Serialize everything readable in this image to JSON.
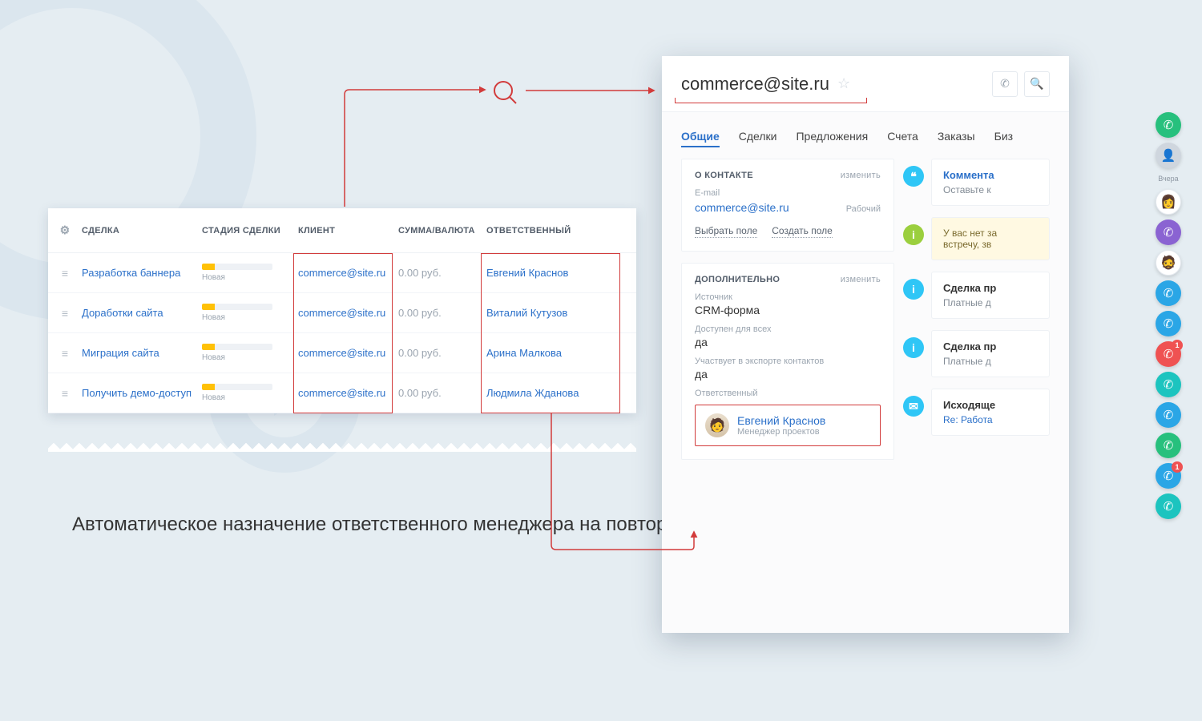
{
  "caption": "Автоматическое назначение ответственного менеджера на повторные обращения клиентов",
  "deals": {
    "headers": {
      "deal": "СДЕЛКА",
      "stage": "СТАДИЯ СДЕЛКИ",
      "client": "КЛИЕНТ",
      "amount": "СУММА/ВАЛЮТА",
      "resp": "ОТВЕТСТВЕННЫЙ"
    },
    "stage_label": "Новая",
    "rows": [
      {
        "name": "Разработка баннера",
        "client": "commerce@site.ru",
        "amount": "0.00 руб.",
        "resp": "Евгений Краснов"
      },
      {
        "name": "Доработки сайта",
        "client": "commerce@site.ru",
        "amount": "0.00 руб.",
        "resp": "Виталий Кутузов"
      },
      {
        "name": "Миграция сайта",
        "client": "commerce@site.ru",
        "amount": "0.00 руб.",
        "resp": "Арина Малкова"
      },
      {
        "name": "Получить демо-доступ",
        "client": "commerce@site.ru",
        "amount": "0.00 руб.",
        "resp": "Людмила Жданова"
      }
    ]
  },
  "card": {
    "title": "commerce@site.ru",
    "tabs": [
      "Общие",
      "Сделки",
      "Предложения",
      "Счета",
      "Заказы",
      "Биз"
    ],
    "about": {
      "header": "О КОНТАКТЕ",
      "edit": "изменить",
      "email_label": "E-mail",
      "email": "commerce@site.ru",
      "type": "Рабочий",
      "pick": "Выбрать поле",
      "create": "Создать поле"
    },
    "extra": {
      "header": "ДОПОЛНИТЕЛЬНО",
      "edit": "изменить",
      "src_l": "Источник",
      "src_v": "CRM-форма",
      "avail_l": "Доступен для всех",
      "avail_v": "да",
      "exp_l": "Участвует в экспорте контактов",
      "exp_v": "да",
      "resp_l": "Ответственный",
      "resp_name": "Евгений Краснов",
      "resp_role": "Менеджер проектов"
    },
    "feed": {
      "comment_t": "Коммента",
      "comment_s": "Оставьте к",
      "warn": "У вас нет за",
      "warn2": "встречу, зв",
      "deal1_t": "Сделка пр",
      "deal1_s": "Платные д",
      "deal2_t": "Сделка пр",
      "deal2_s": "Платные д",
      "out_t": "Исходяще",
      "out_s": "Re: Работа"
    }
  },
  "dock": {
    "label": "Вчера",
    "badge": "1"
  }
}
